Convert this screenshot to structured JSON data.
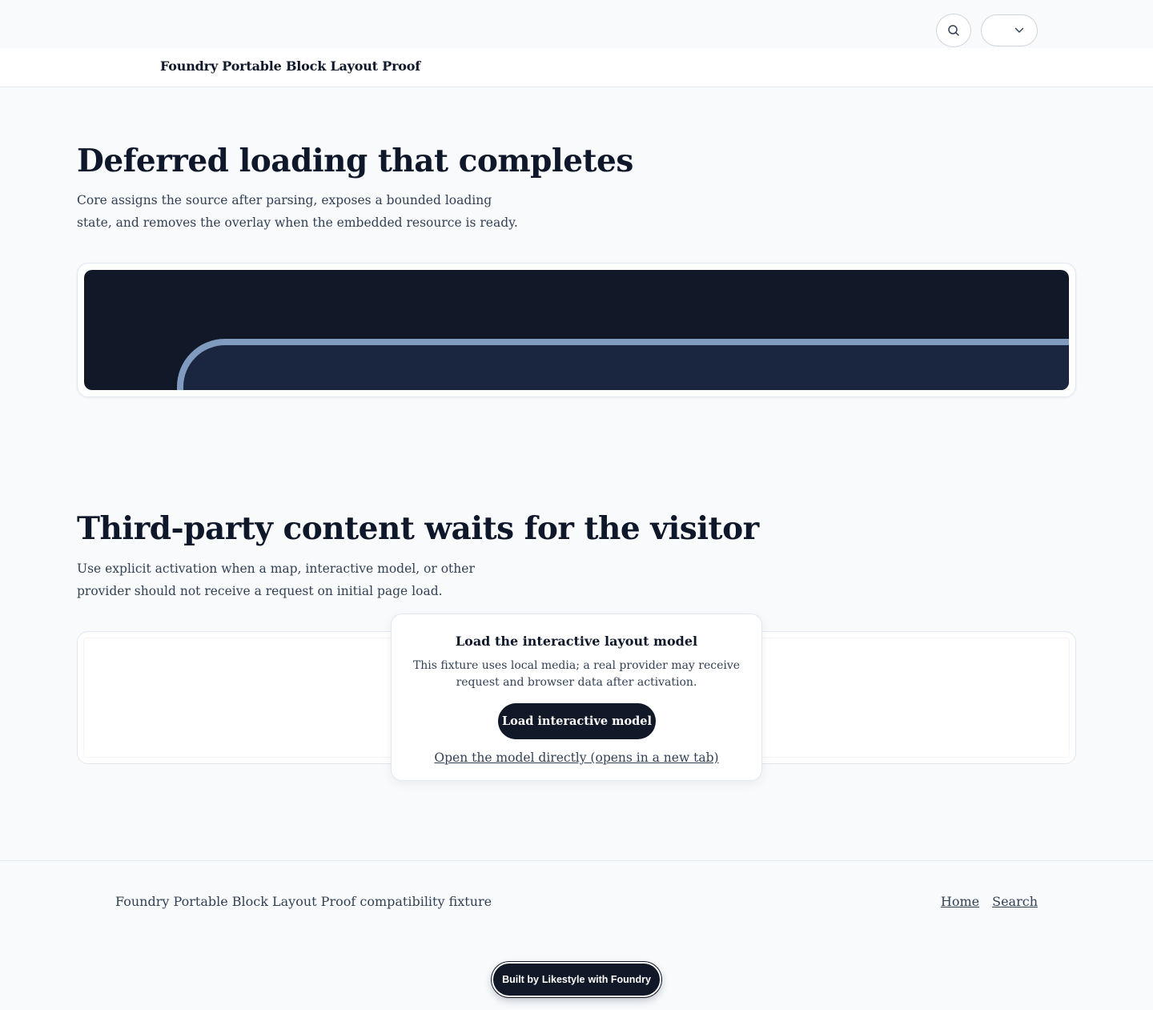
{
  "utility": {
    "search_icon": "search-icon",
    "language_icon": "chevron-down-icon"
  },
  "header": {
    "site_title": "Foundry Portable Block Layout Proof"
  },
  "section1": {
    "heading": "Deferred loading that completes",
    "lede": "Core assigns the source after parsing, exposes a bounded loading state, and removes the overlay when the embedded resource is ready."
  },
  "section2": {
    "heading": "Third-party content waits for the visitor",
    "lede": "Use explicit activation when a map, interactive model, or other provider should not receive a request on initial page load.",
    "consent": {
      "title": "Load the interactive layout model",
      "description": "This fixture uses local media; a real provider may receive request and browser data after activation.",
      "button_label": "Load interactive model",
      "link_label": "Open the model directly (opens in a new tab)"
    }
  },
  "footer": {
    "text": "Foundry Portable Block Layout Proof compatibility fixture",
    "nav": [
      {
        "label": "Home"
      },
      {
        "label": "Search"
      }
    ]
  },
  "badge": {
    "prefix": "Built by",
    "brand": "Likestyle",
    "suffix": "with Foundry"
  },
  "colors": {
    "ink": "#0f172a",
    "dark_panel": "#111827",
    "arc": "#7f9bbf",
    "border": "#e2e8f0"
  }
}
